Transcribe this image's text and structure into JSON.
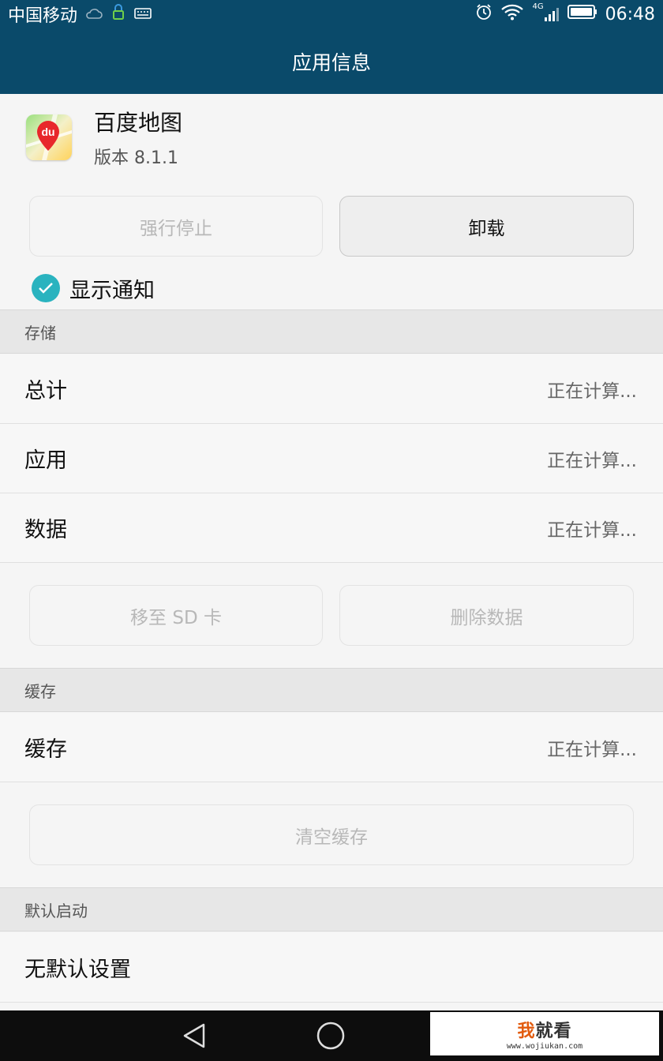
{
  "status_bar": {
    "carrier": "中国移动",
    "network": "4G",
    "time": "06:48",
    "icons": [
      "cloud-icon",
      "vpn-lock-icon",
      "keyboard-icon",
      "alarm-icon",
      "wifi-icon",
      "signal-icon",
      "battery-icon"
    ]
  },
  "title_bar": {
    "title": "应用信息"
  },
  "app": {
    "name": "百度地图",
    "version": "版本 8.1.1",
    "icon": "baidu-map-icon",
    "icon_text": "du"
  },
  "actions": {
    "force_stop": "强行停止",
    "uninstall": "卸载"
  },
  "notification": {
    "label": "显示通知",
    "checked": true
  },
  "storage": {
    "header": "存储",
    "rows": [
      {
        "label": "总计",
        "value": "正在计算..."
      },
      {
        "label": "应用",
        "value": "正在计算..."
      },
      {
        "label": "数据",
        "value": "正在计算..."
      }
    ],
    "move_to_sd": "移至 SD 卡",
    "clear_data": "删除数据"
  },
  "cache": {
    "header": "缓存",
    "row": {
      "label": "缓存",
      "value": "正在计算..."
    },
    "clear_cache": "清空缓存"
  },
  "default_launch": {
    "header": "默认启动",
    "row": {
      "label": "无默认设置"
    }
  },
  "nav_bar": {
    "icons": [
      "back-icon",
      "home-icon"
    ]
  },
  "watermark": {
    "title_accent": "我",
    "title_rest": "就看",
    "url": "www.wojiukan.com"
  },
  "colors": {
    "primary": "#0a4a6a",
    "accent": "#2ab3bf",
    "brand_red": "#e8272b"
  }
}
